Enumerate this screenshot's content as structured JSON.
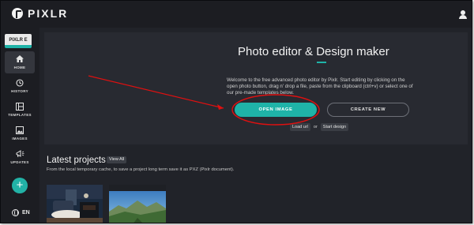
{
  "app": {
    "logo_text": "PIXLR",
    "product_badge": "PIXLR E"
  },
  "sidebar": {
    "items": [
      {
        "label": "HOME",
        "icon": "home-icon"
      },
      {
        "label": "HISTORY",
        "icon": "history-icon"
      },
      {
        "label": "TEMPLATES",
        "icon": "templates-icon"
      },
      {
        "label": "IMAGES",
        "icon": "images-icon"
      },
      {
        "label": "UPDATES",
        "icon": "updates-icon"
      }
    ],
    "fab_label": "+",
    "language": "EN"
  },
  "hero": {
    "title": "Photo editor & Design maker",
    "description": "Welcome to the free advanced photo editor by Pixlr. Start editing by clicking on the open photo button, drag n' drop a file, paste from the clipboard (ctrl+v) or select one of our pre-made templates below.",
    "open_button": "OPEN IMAGE",
    "create_button": "CREATE NEW",
    "load_url_label": "Load url",
    "or_label": "or",
    "start_design_label": "Start design"
  },
  "latest": {
    "title": "Latest projects",
    "view_all": "View All",
    "description": "From the local temporary cache, to save a project long term save it as PXZ (Pixlr document)."
  },
  "colors": {
    "accent": "#1fb3a8",
    "annotation": "#e01010",
    "background": "#212329",
    "panel": "#282a31"
  }
}
